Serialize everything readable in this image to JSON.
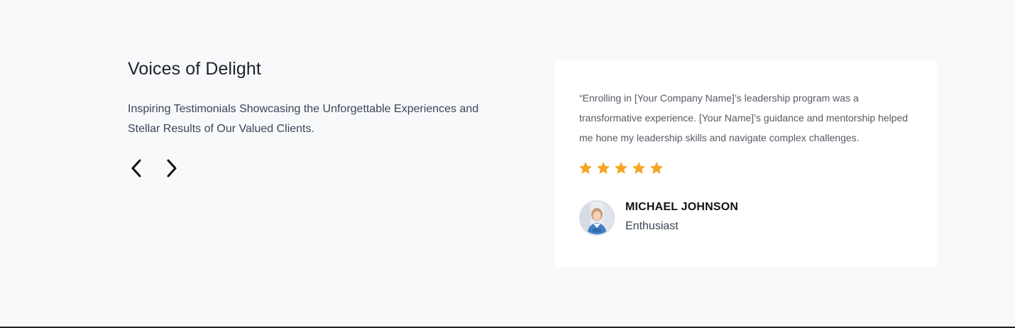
{
  "testimonials": {
    "heading": "Voices of Delight",
    "subtitle": "Inspiring Testimonials Showcasing the Unforgettable Experiences and Stellar Results of Our Valued Clients.",
    "nav": {
      "prev_icon": "chevron-left-icon",
      "next_icon": "chevron-right-icon"
    },
    "card": {
      "quote": "“Enrolling in [Your Company Name]’s leadership program was a transformative experience. [Your Name]’s guidance and mentorship helped me hone my leadership skills and navigate complex challenges.",
      "rating": 5,
      "rating_max": 5,
      "author_name": "MICHAEL JOHNSON",
      "author_role": "Enthusiast"
    },
    "colors": {
      "star": "#f5a623",
      "background": "#f8f9fb",
      "card": "#ffffff"
    }
  }
}
